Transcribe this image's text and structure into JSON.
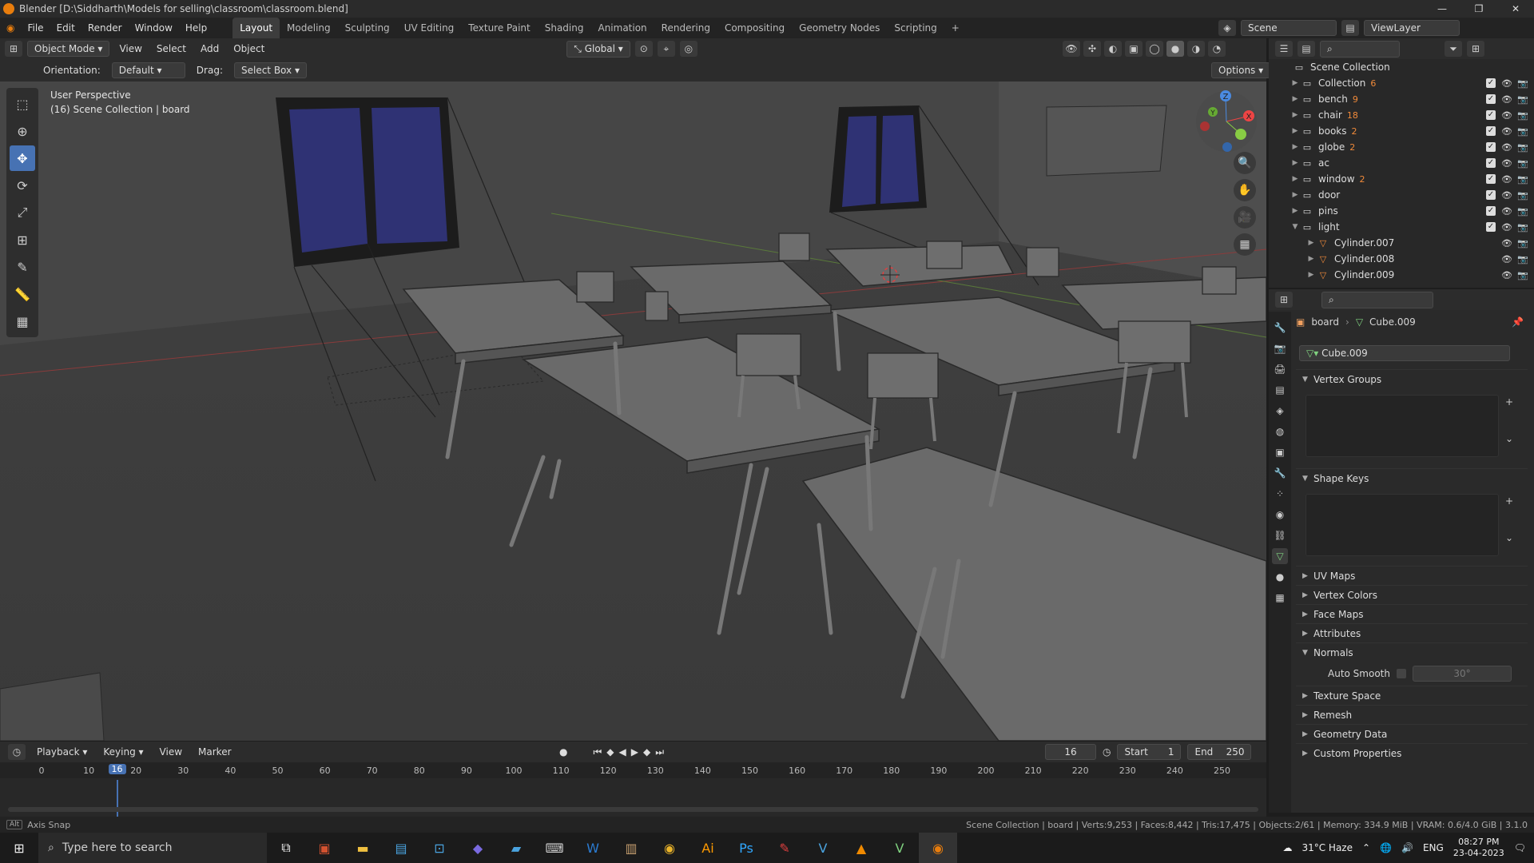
{
  "window": {
    "title": "Blender [D:\\Siddharth\\Models for selling\\classroom\\classroom.blend]"
  },
  "menus": [
    "File",
    "Edit",
    "Render",
    "Window",
    "Help"
  ],
  "workspaces": [
    "Layout",
    "Modeling",
    "Sculpting",
    "UV Editing",
    "Texture Paint",
    "Shading",
    "Animation",
    "Rendering",
    "Compositing",
    "Geometry Nodes",
    "Scripting"
  ],
  "scene": {
    "label": "Scene",
    "viewlayer": "ViewLayer"
  },
  "header": {
    "mode": "Object Mode",
    "menus": [
      "View",
      "Select",
      "Add",
      "Object"
    ],
    "transform": "Global",
    "options": "Options",
    "orientation_label": "Orientation:",
    "orientation_value": "Default",
    "drag_label": "Drag:",
    "drag_value": "Select Box"
  },
  "viewport": {
    "perspective": "User Perspective",
    "context": "(16) Scene Collection | board"
  },
  "gizmo": {
    "x": "X",
    "y": "Y",
    "z": "Z"
  },
  "outliner": {
    "root": "Scene Collection",
    "items": [
      {
        "name": "Collection",
        "count": "6"
      },
      {
        "name": "bench",
        "count": "9"
      },
      {
        "name": "chair",
        "count": "18"
      },
      {
        "name": "books",
        "count": "2"
      },
      {
        "name": "globe",
        "count": "2"
      },
      {
        "name": "ac",
        "count": ""
      },
      {
        "name": "window",
        "count": "2"
      },
      {
        "name": "door",
        "count": ""
      },
      {
        "name": "pins",
        "count": ""
      },
      {
        "name": "light",
        "count": ""
      }
    ],
    "children": [
      "Cylinder.007",
      "Cylinder.008",
      "Cylinder.009"
    ]
  },
  "properties": {
    "breadcrumb_object": "board",
    "breadcrumb_data": "Cube.009",
    "data_name": "Cube.009",
    "panels": {
      "vertex_groups": "Vertex Groups",
      "shape_keys": "Shape Keys",
      "uv_maps": "UV Maps",
      "vertex_colors": "Vertex Colors",
      "face_maps": "Face Maps",
      "attributes": "Attributes",
      "normals": "Normals",
      "auto_smooth": "Auto Smooth",
      "auto_smooth_angle": "30°",
      "texture_space": "Texture Space",
      "remesh": "Remesh",
      "geometry_data": "Geometry Data",
      "custom_properties": "Custom Properties"
    }
  },
  "timeline": {
    "menus": [
      "Playback",
      "Keying",
      "View",
      "Marker"
    ],
    "current_frame": "16",
    "start_label": "Start",
    "start": "1",
    "end_label": "End",
    "end": "250",
    "ticks": [
      "0",
      "10",
      "20",
      "30",
      "40",
      "50",
      "60",
      "70",
      "80",
      "90",
      "100",
      "110",
      "120",
      "130",
      "140",
      "150",
      "160",
      "170",
      "180",
      "190",
      "200",
      "210",
      "220",
      "230",
      "240",
      "250"
    ]
  },
  "status": {
    "left": "Axis Snap",
    "right": "Scene Collection | board | Verts:9,253 | Faces:8,442 | Tris:17,475 | Objects:2/61 | Memory: 334.9 MiB | VRAM: 0.6/4.0 GiB | 3.1.0"
  },
  "taskbar": {
    "search_placeholder": "Type here to search",
    "weather": "31°C Haze",
    "lang": "ENG",
    "time": "08:27 PM",
    "date": "23-04-2023"
  }
}
